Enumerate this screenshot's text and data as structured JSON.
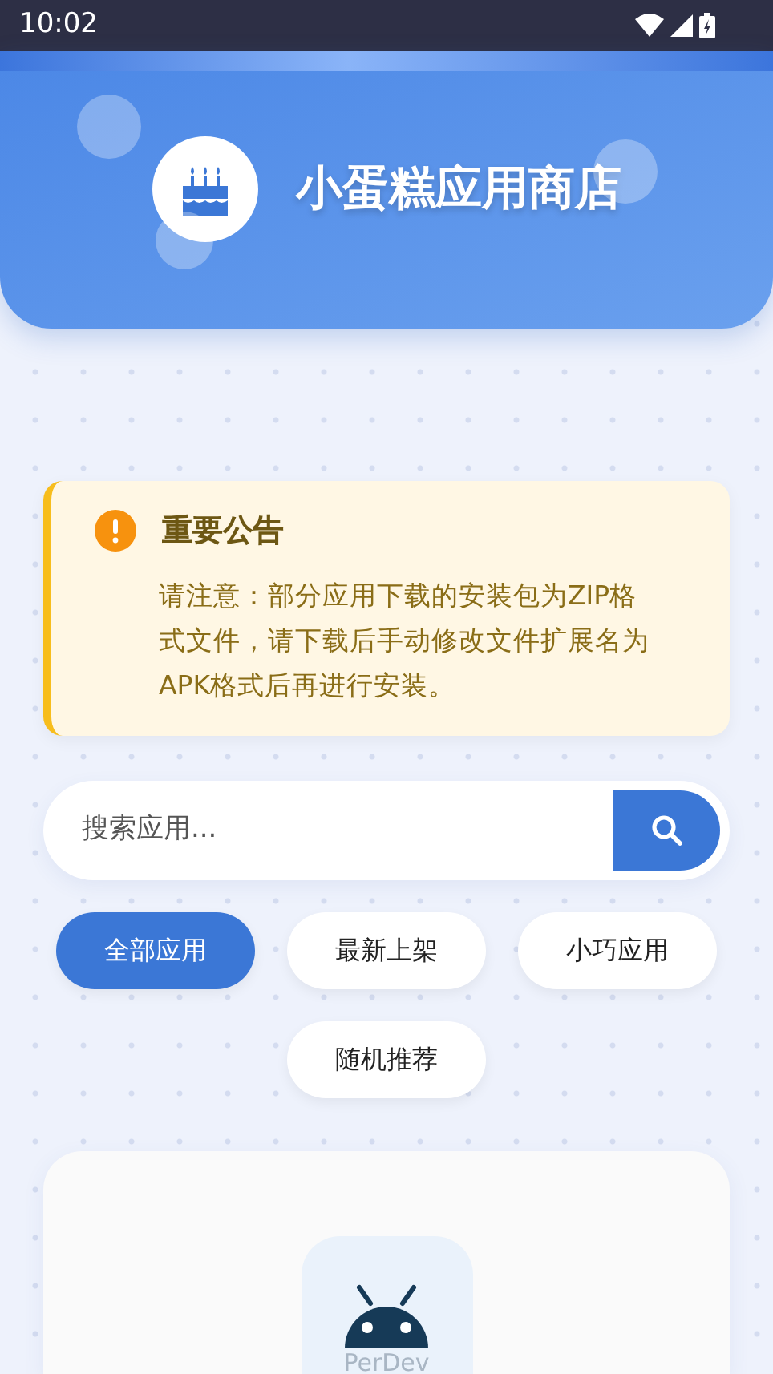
{
  "status_bar": {
    "time": "10:02"
  },
  "header": {
    "title": "小蛋糕应用商店"
  },
  "notice": {
    "title": "重要公告",
    "text": "请注意：部分应用下载的安装包为ZIP格式文件，请下载后手动修改文件扩展名为APK格式后再进行安装。"
  },
  "search": {
    "placeholder": "搜索应用..."
  },
  "filters": [
    {
      "label": "全部应用",
      "selected": true
    },
    {
      "label": "最新上架",
      "selected": false
    },
    {
      "label": "小巧应用",
      "selected": false
    },
    {
      "label": "随机推荐",
      "selected": false
    }
  ],
  "app_card": {
    "icon_caption": "PerDev"
  }
}
